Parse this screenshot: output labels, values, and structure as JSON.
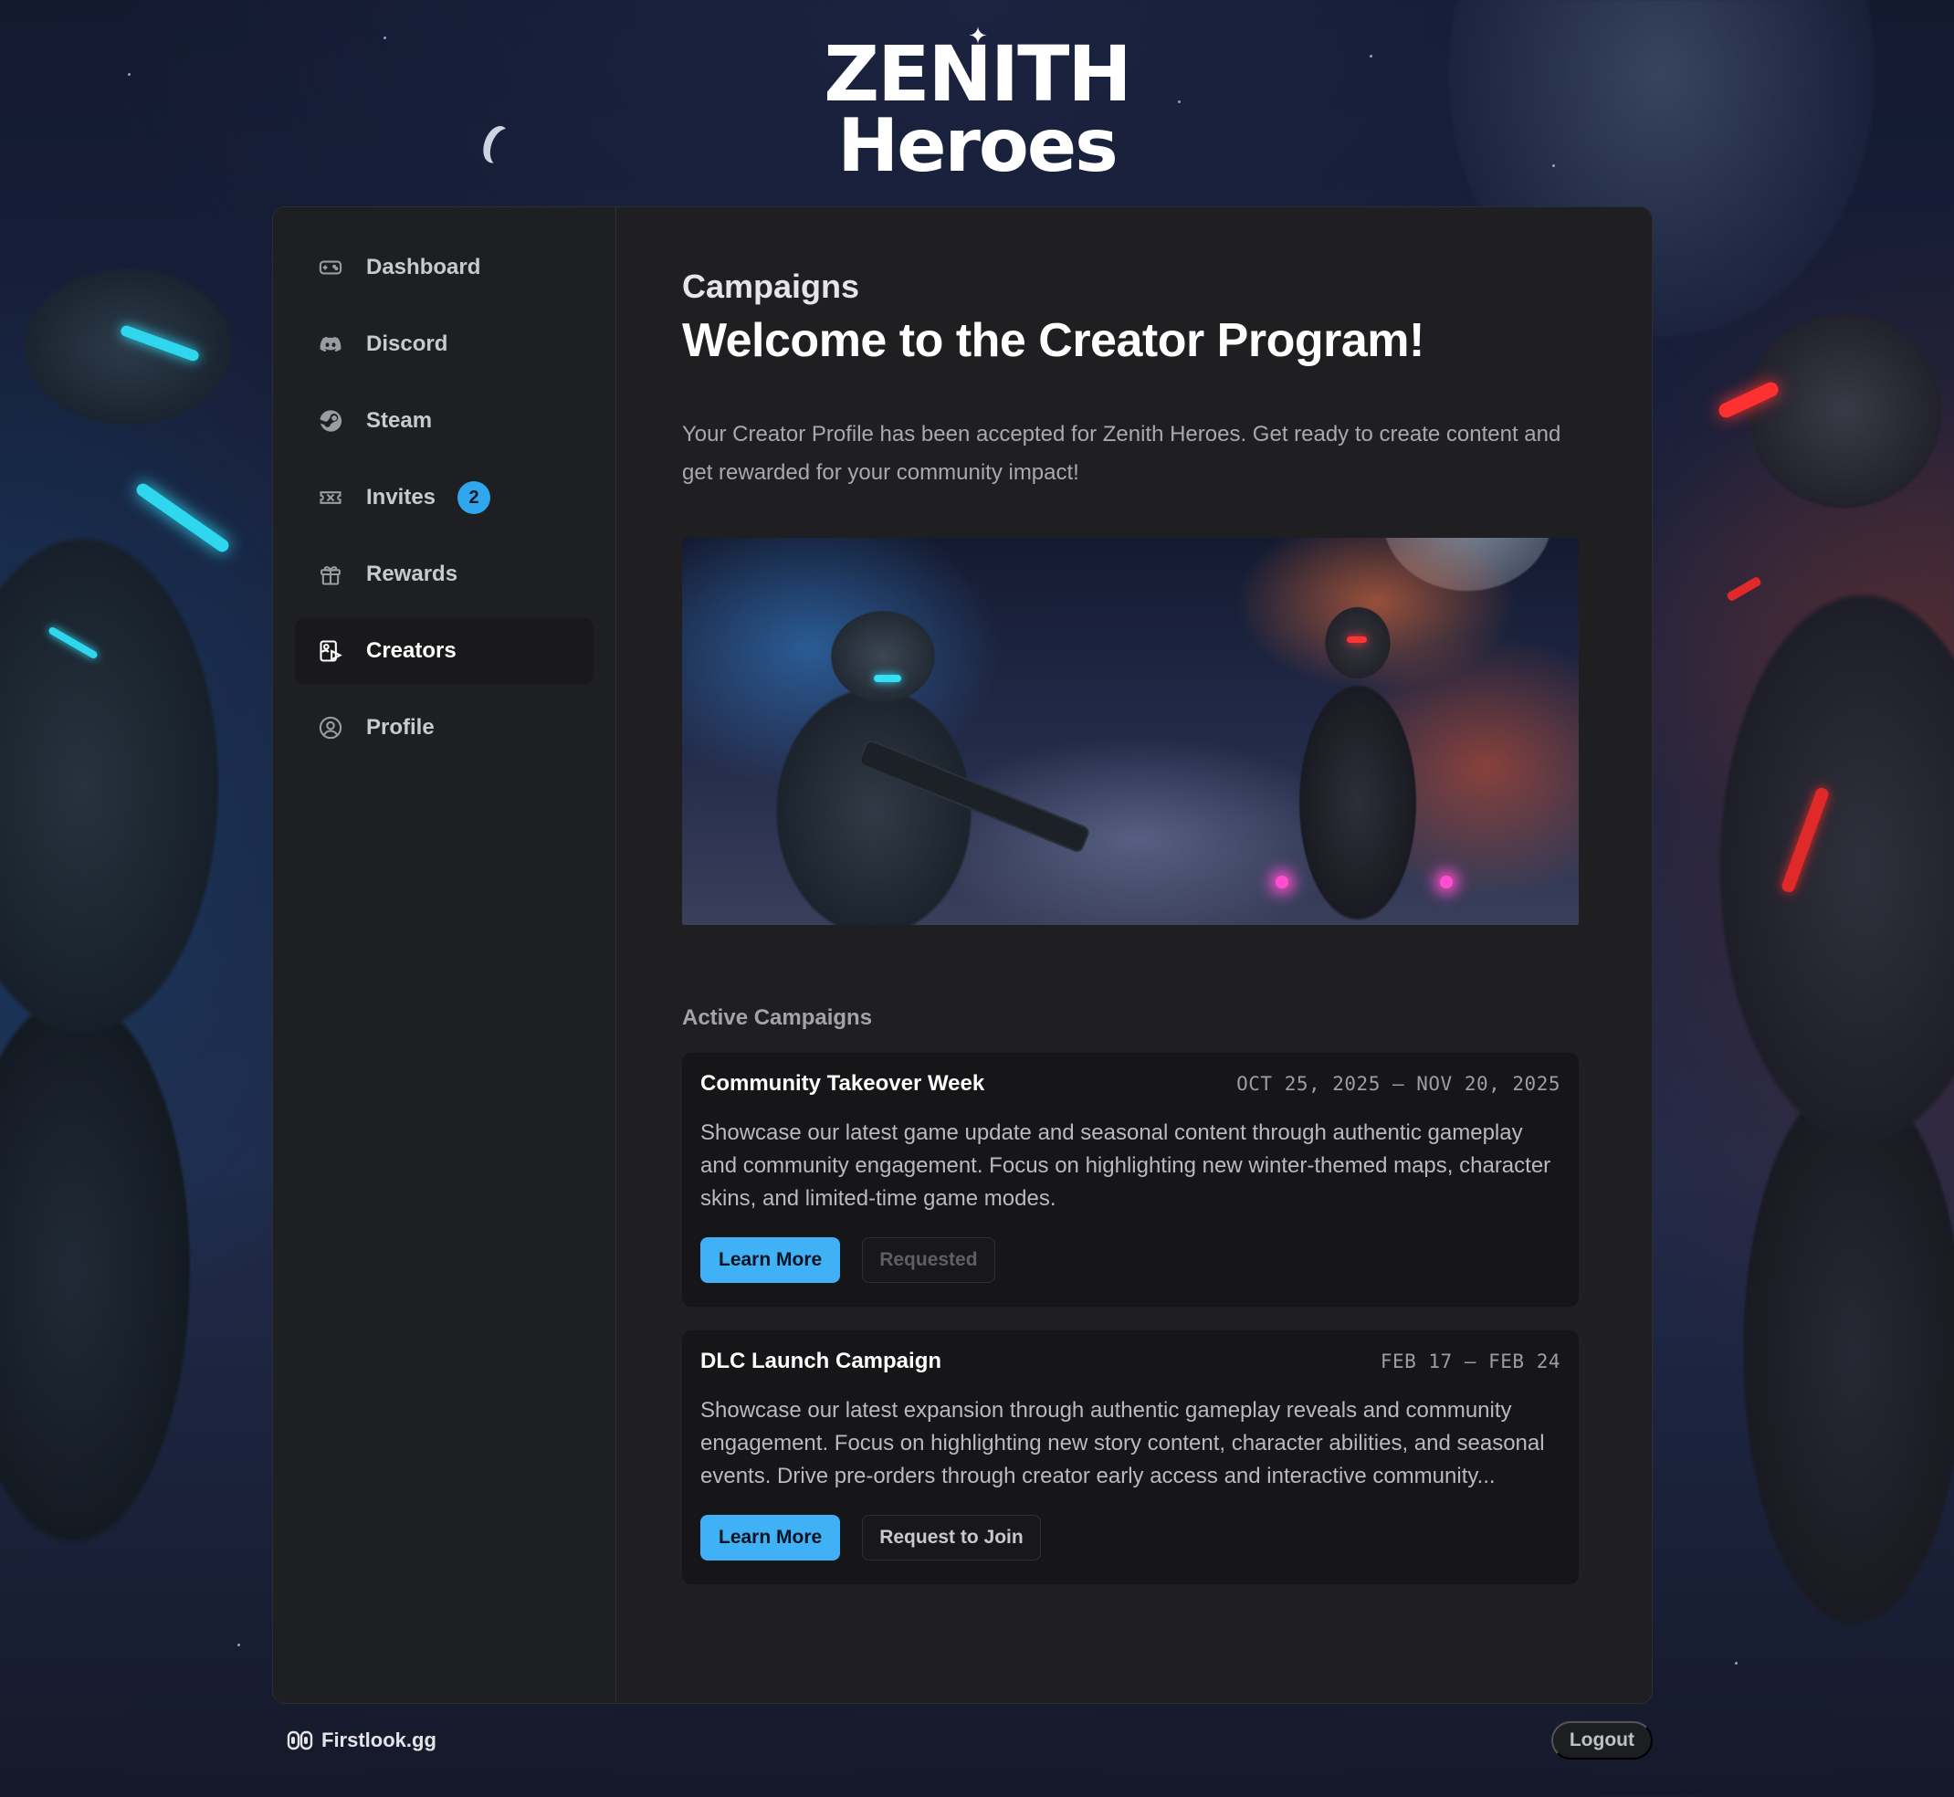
{
  "brand": {
    "logo_line1": "ZENITH",
    "logo_line2": "Heroes"
  },
  "sidebar": {
    "items": [
      {
        "label": "Dashboard",
        "icon": "gamepad-icon",
        "active": false
      },
      {
        "label": "Discord",
        "icon": "discord-icon",
        "active": false
      },
      {
        "label": "Steam",
        "icon": "steam-icon",
        "active": false
      },
      {
        "label": "Invites",
        "icon": "ticket-icon",
        "active": false,
        "badge": "2"
      },
      {
        "label": "Rewards",
        "icon": "gift-icon",
        "active": false
      },
      {
        "label": "Creators",
        "icon": "creator-media-icon",
        "active": true
      },
      {
        "label": "Profile",
        "icon": "user-circle-icon",
        "active": false
      }
    ]
  },
  "main": {
    "eyebrow": "Campaigns",
    "title": "Welcome to the Creator Program!",
    "intro": "Your Creator Profile has been accepted for Zenith Heroes. Get ready to create content and get rewarded for your community impact!",
    "section_label": "Active Campaigns",
    "campaigns": [
      {
        "name": "Community Takeover Week",
        "dates": "OCT 25, 2025 – NOV 20, 2025",
        "description": "Showcase our latest game update and seasonal content through authentic gameplay and community engagement. Focus on highlighting new winter-themed maps, character skins, and limited-time game modes.",
        "primary_label": "Learn More",
        "secondary_label": "Requested",
        "secondary_disabled": true
      },
      {
        "name": "DLC Launch Campaign",
        "dates": "FEB 17 – FEB 24",
        "description": "Showcase our latest expansion through authentic gameplay reveals and community engagement. Focus on highlighting new story content, character abilities, and seasonal events. Drive pre-orders through creator early access and interactive community...",
        "primary_label": "Learn More",
        "secondary_label": "Request to Join",
        "secondary_disabled": false
      }
    ]
  },
  "footer": {
    "brand_label": "Firstlook.gg",
    "logout_label": "Logout"
  },
  "colors": {
    "accent": "#3fb1f4",
    "badge": "#2ea7ee",
    "card_bg": "#1f1f22",
    "campaign_bg": "#161618"
  }
}
